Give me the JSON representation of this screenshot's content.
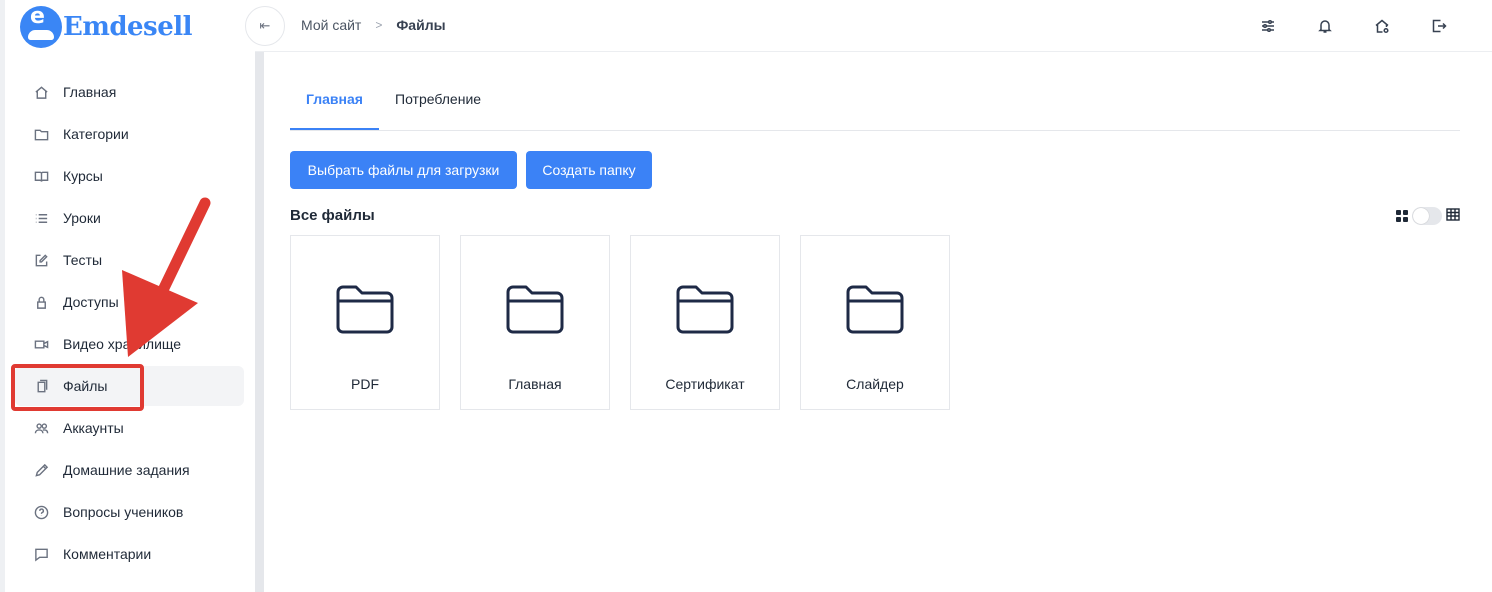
{
  "brand": {
    "name": "Emdesell",
    "badge_letter": "e",
    "color": "#3a86f5"
  },
  "sidebar": {
    "items": [
      {
        "label": "Главная",
        "icon": "home-icon"
      },
      {
        "label": "Категории",
        "icon": "folder-icon"
      },
      {
        "label": "Курсы",
        "icon": "book-icon"
      },
      {
        "label": "Уроки",
        "icon": "list-icon"
      },
      {
        "label": "Тесты",
        "icon": "edit-icon"
      },
      {
        "label": "Доступы",
        "icon": "lock-icon"
      },
      {
        "label": "Видео хранилище",
        "icon": "video-icon"
      },
      {
        "label": "Файлы",
        "icon": "file-icon",
        "active": true
      },
      {
        "label": "Аккаунты",
        "icon": "users-icon"
      },
      {
        "label": "Домашние задания",
        "icon": "pencil-icon"
      },
      {
        "label": "Вопросы учеников",
        "icon": "question-icon"
      },
      {
        "label": "Комментарии",
        "icon": "comment-icon"
      }
    ]
  },
  "header": {
    "collapse_icon": "collapse-left-icon",
    "breadcrumb": {
      "parent": "Мой сайт",
      "separator": ">",
      "current": "Файлы"
    },
    "icons": [
      "sliders-icon",
      "bell-icon",
      "home-settings-icon",
      "logout-icon"
    ]
  },
  "main": {
    "tabs": [
      {
        "label": "Главная",
        "active": true
      },
      {
        "label": "Потребление",
        "active": false
      }
    ],
    "buttons": {
      "upload_label": "Выбрать файлы для загрузки",
      "create_folder_label": "Создать папку"
    },
    "section_title": "Все файлы",
    "view_toggle": {
      "grid_icon": "grid-view-icon",
      "table_icon": "table-view-icon",
      "selected": "grid"
    },
    "folders": [
      {
        "name": "PDF",
        "icon": "folder-icon"
      },
      {
        "name": "Главная",
        "icon": "folder-icon"
      },
      {
        "name": "Сертификат",
        "icon": "folder-icon"
      },
      {
        "name": "Слайдер",
        "icon": "folder-icon"
      }
    ]
  },
  "colors": {
    "accent": "#3b82f6",
    "annotation": "#e03a32",
    "folder_stroke": "#1e2a46"
  }
}
